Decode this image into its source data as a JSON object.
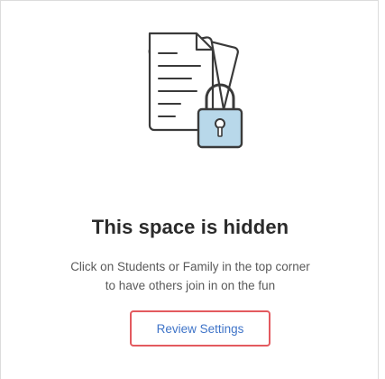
{
  "empty_state": {
    "illustration": "documents-lock-icon",
    "title": "This space is hidden",
    "description_line1": "Click on Students or Family in the top corner",
    "description_line2": "to have others join in on the fun",
    "button_label": "Review Settings"
  },
  "colors": {
    "button_text": "#3f74c8",
    "highlight_border": "#e35a5f",
    "title_text": "#2b2b2b",
    "illustration_accent": "#b8d8ea"
  }
}
